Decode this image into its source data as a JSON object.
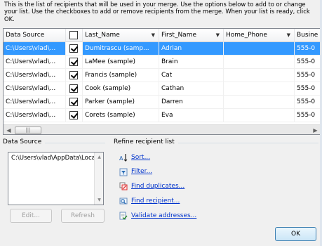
{
  "intro": "This is the list of recipients that will be used in your merge.  Use the options below to add to or change your list.  Use the checkboxes to add or remove recipients from the merge.  When your list is ready, click OK.",
  "grid": {
    "columns": [
      {
        "label": "Data Source",
        "dropdown": false
      },
      {
        "label": "",
        "dropdown": false
      },
      {
        "label": "Last_Name",
        "dropdown": true
      },
      {
        "label": "First_Name",
        "dropdown": true
      },
      {
        "label": "Home_Phone",
        "dropdown": true
      },
      {
        "label": "Busine",
        "dropdown": false
      }
    ],
    "rows": [
      {
        "source": "C:\\Users\\vlad\\...",
        "checked": true,
        "last": "Dumitrascu (samp...",
        "first": "Adrian",
        "phone": "",
        "business": "555-0",
        "selected": true
      },
      {
        "source": "C:\\Users\\vlad\\...",
        "checked": true,
        "last": "LaMee (sample)",
        "first": "Brain",
        "phone": "",
        "business": "555-0",
        "selected": false
      },
      {
        "source": "C:\\Users\\vlad\\...",
        "checked": true,
        "last": "Francis (sample)",
        "first": "Cat",
        "phone": "",
        "business": "555-0",
        "selected": false
      },
      {
        "source": "C:\\Users\\vlad\\...",
        "checked": true,
        "last": "Cook (sample)",
        "first": "Cathan",
        "phone": "",
        "business": "555-0",
        "selected": false
      },
      {
        "source": "C:\\Users\\vlad\\...",
        "checked": true,
        "last": "Parker (sample)",
        "first": "Darren",
        "phone": "",
        "business": "555-0",
        "selected": false
      },
      {
        "source": "C:\\Users\\vlad\\...",
        "checked": true,
        "last": "Corets (sample)",
        "first": "Eva",
        "phone": "",
        "business": "555-0",
        "selected": false
      }
    ]
  },
  "data_source": {
    "title": "Data Source",
    "items": [
      "C:\\Users\\vlad\\AppData\\Loca"
    ],
    "edit_label": "Edit...",
    "refresh_label": "Refresh"
  },
  "refine": {
    "title": "Refine recipient list",
    "links": [
      {
        "label": "Sort...",
        "icon": "sort-icon"
      },
      {
        "label": "Filter...",
        "icon": "filter-icon"
      },
      {
        "label": "Find duplicates...",
        "icon": "find-duplicates-icon"
      },
      {
        "label": "Find recipient...",
        "icon": "find-recipient-icon"
      },
      {
        "label": "Validate addresses...",
        "icon": "validate-addresses-icon"
      }
    ]
  },
  "ok_label": "OK",
  "colors": {
    "selection": "#3399ff",
    "link": "#0033cc"
  }
}
